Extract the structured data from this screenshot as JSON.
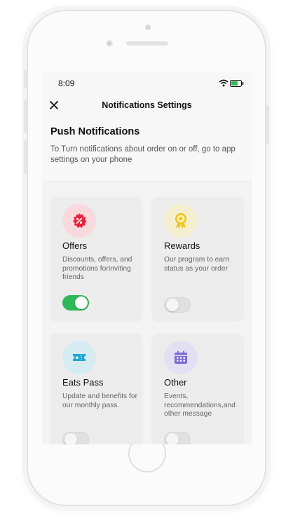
{
  "status_bar": {
    "time": "8:09",
    "icons": [
      "wifi-icon",
      "battery-icon"
    ],
    "battery_color": "#2fb858"
  },
  "navbar": {
    "title": "Notifications Settings",
    "close_icon": "close-icon"
  },
  "header": {
    "title": "Push Notifications",
    "description": "To Turn notifications about order on or off, go to app settings on your phone"
  },
  "cards": [
    {
      "title": "Offers",
      "description": "Discounts, offers, and promotions forinviting friends",
      "icon": "percent-badge-icon",
      "icon_color": "#e8223a",
      "icon_bg": "#f7d9de",
      "enabled": true
    },
    {
      "title": "Rewards",
      "description": "Our program to earn status as your order",
      "icon": "award-ribbon-icon",
      "icon_color": "#f2c318",
      "icon_bg": "#f6efcf",
      "enabled": false
    },
    {
      "title": "Eats Pass",
      "description": "Update and benefits for our monthly pass.",
      "icon": "ticket-icon",
      "icon_color": "#1fa6d6",
      "icon_bg": "#d6ecf3",
      "enabled": false
    },
    {
      "title": "Other",
      "description": "Events, recommendations,and other message",
      "icon": "calendar-icon",
      "icon_color": "#7c6ad6",
      "icon_bg": "#e3e0f4",
      "enabled": false
    }
  ],
  "colors": {
    "toggle_on": "#2fb858",
    "toggle_off": "#e0e0e0"
  }
}
